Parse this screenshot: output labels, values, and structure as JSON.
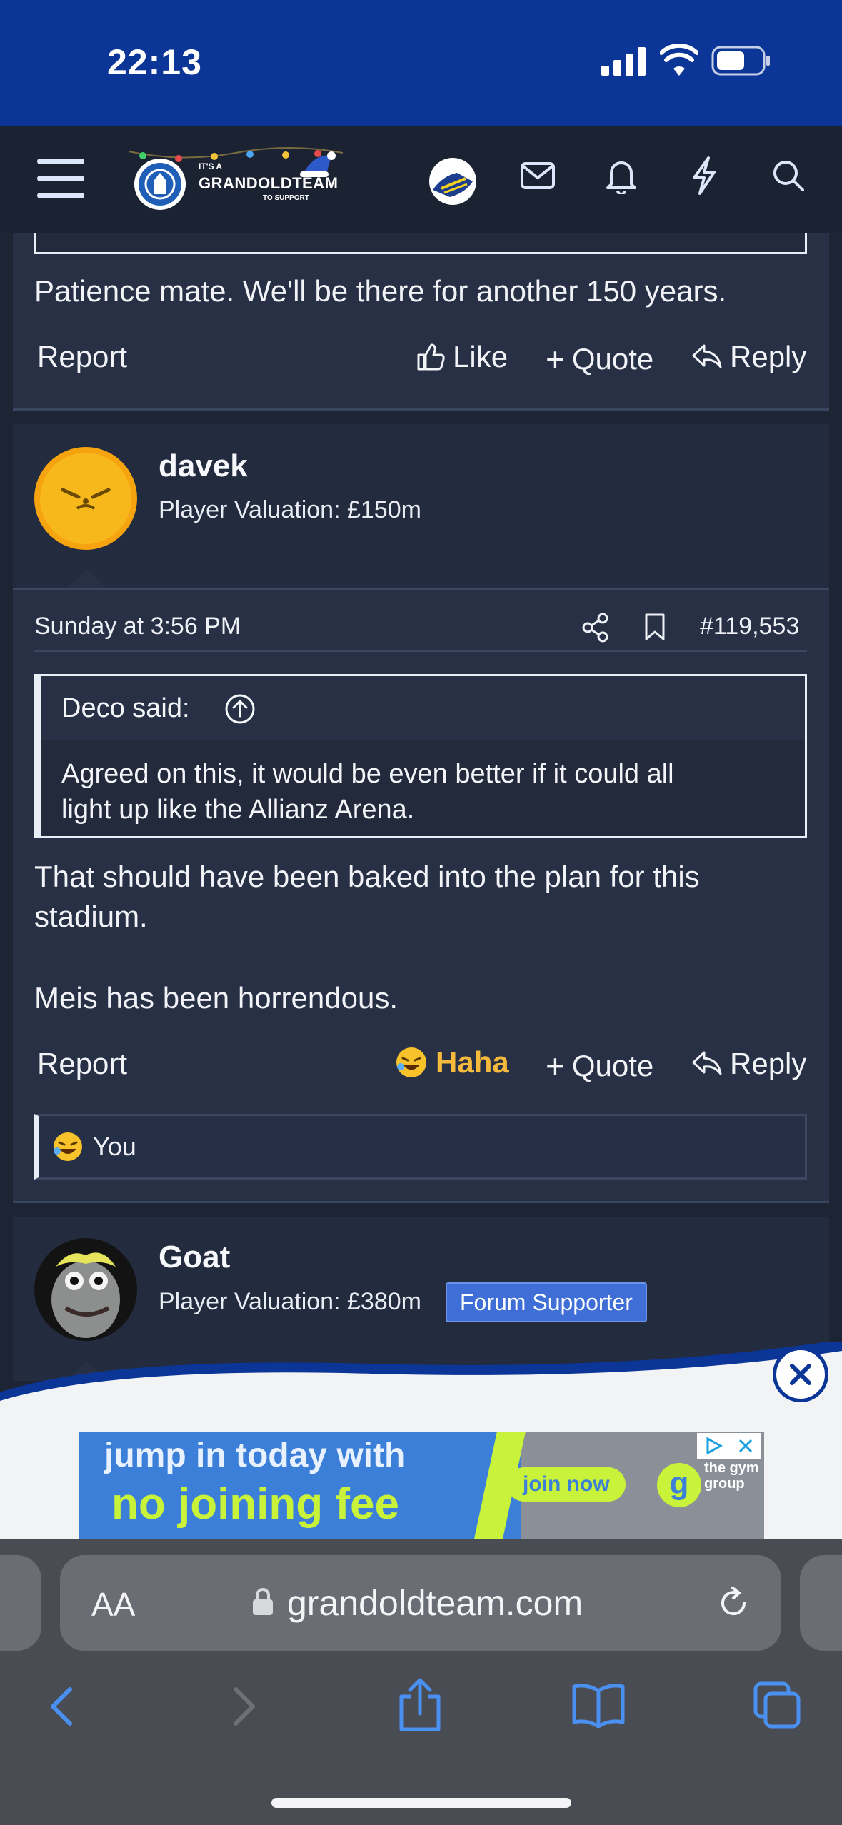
{
  "status_bar": {
    "time": "22:13"
  },
  "nav": {
    "logo_small": "IT'S A",
    "logo_main": "GRANDOLDTEAM",
    "logo_sub": "TO SUPPORT",
    "icons": [
      "menu-icon",
      "avatar",
      "mail-icon",
      "bell-icon",
      "bolt-icon",
      "search-icon"
    ]
  },
  "post1": {
    "body": "Patience mate. We'll be there for another 150 years.",
    "report": "Report",
    "like": "Like",
    "quote": "Quote",
    "reply": "Reply"
  },
  "post2": {
    "username": "davek",
    "valuation": "Player Valuation: £150m",
    "date": "Sunday at 3:56 PM",
    "post_number": "#119,553",
    "quote_author": "Deco said:",
    "quote_text_line1": "Agreed on this, it would be even better if it could all",
    "quote_text_line2": "light up like the Allianz Arena.",
    "body_line1": "That should have been baked into the plan for this",
    "body_line2": "stadium.",
    "body_line3": "Meis has been horrendous.",
    "report": "Report",
    "reaction": "Haha",
    "quote": "Quote",
    "reply": "Reply",
    "reacted_by": "You",
    "reaction_color": "#f5b93b"
  },
  "post3": {
    "username": "Goat",
    "valuation": "Player Valuation: £380m",
    "badge": "Forum Supporter",
    "badge_color": "#3f6fd6"
  },
  "ad": {
    "line1": "jump in today with",
    "line2": "no joining fee",
    "cta": "join now",
    "brand": "the gym group"
  },
  "browser": {
    "text_size": "AA",
    "url": "grandoldteam.com"
  },
  "colors": {
    "status_bar": "#0b3596",
    "accent_blue": "#4a90f0",
    "ad_green": "#c9f23a"
  }
}
